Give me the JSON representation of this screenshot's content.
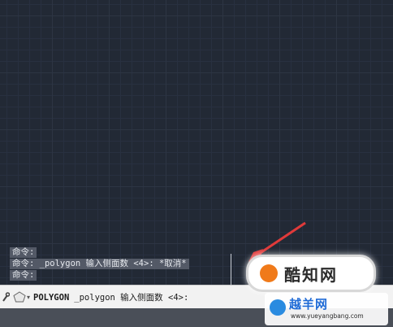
{
  "command_history": [
    "命令:",
    "命令: _polygon 输入侧面数 <4>: *取消*",
    "命令:"
  ],
  "command_line": {
    "keyword": "POLYGON",
    "prompt": "_polygon 输入侧面数 <4>:",
    "icon": "polygon-icon"
  },
  "watermarks": {
    "badge_text": "酷知网",
    "site_title": "越羊网",
    "site_url": "www.yueyangbang.com"
  },
  "colors": {
    "canvas_background": "#222935",
    "annotation_arrow": "#e03a3a"
  }
}
